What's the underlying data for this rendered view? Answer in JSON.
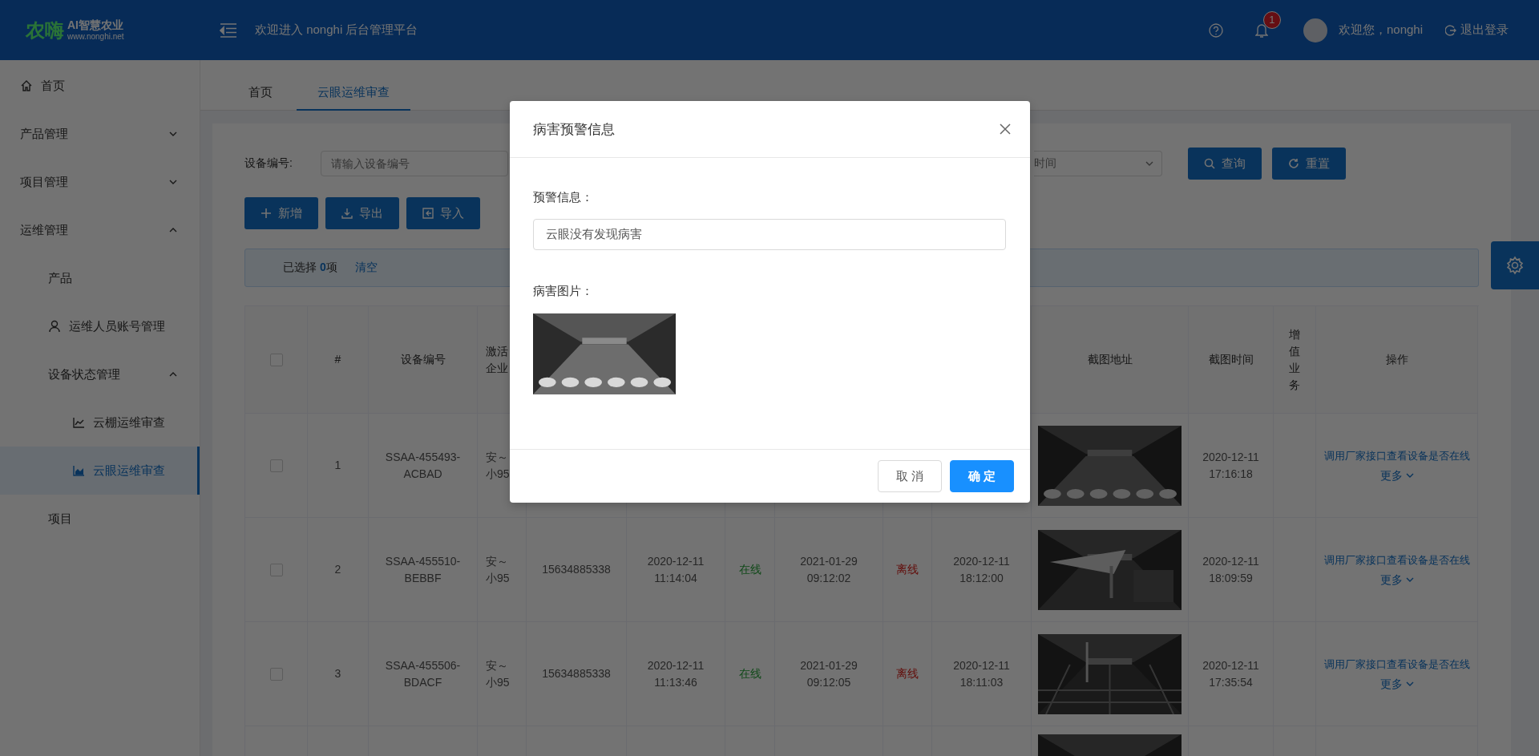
{
  "header": {
    "logo_mark": "农嗨",
    "logo_title": "AI智慧农业",
    "logo_url": "www.nonghi.net",
    "title": "欢迎进入 nonghi 后台管理平台",
    "notification_count": "1",
    "greeting": "欢迎您，nonghi",
    "logout": "退出登录"
  },
  "sidebar": {
    "items": [
      {
        "label": "首页",
        "kind": "home",
        "selected": false
      },
      {
        "label": "产品管理",
        "kind": "group",
        "expanded": false,
        "selected": false
      },
      {
        "label": "项目管理",
        "kind": "group",
        "expanded": false,
        "selected": false
      },
      {
        "label": "运维管理",
        "kind": "group",
        "expanded": true,
        "selected": false,
        "children": [
          {
            "label": "产品",
            "kind": "link",
            "selected": false
          },
          {
            "label": "运维人员账号管理",
            "kind": "user",
            "selected": false
          },
          {
            "label": "设备状态管理",
            "kind": "group",
            "expanded": true,
            "selected": false,
            "children": [
              {
                "label": "云棚运维审查",
                "kind": "linechart",
                "selected": false
              },
              {
                "label": "云眼运维审查",
                "kind": "areachart",
                "selected": true
              }
            ]
          },
          {
            "label": "项目",
            "kind": "link",
            "selected": false
          }
        ]
      }
    ]
  },
  "tabs": [
    {
      "label": "首页",
      "selected": false
    },
    {
      "label": "云眼运维审查",
      "selected": true
    }
  ],
  "filters": {
    "device_label": "设备编号:",
    "device_placeholder": "请输入设备编号",
    "time_placeholder": "时间",
    "buttons": [
      {
        "label": "查询",
        "kind": "search"
      },
      {
        "label": "重置",
        "kind": "reset"
      }
    ]
  },
  "toolbar": [
    {
      "label": "新增",
      "kind": "plus"
    },
    {
      "label": "导出",
      "kind": "export"
    },
    {
      "label": "导入",
      "kind": "import"
    }
  ],
  "selection": {
    "text": "已选择 **0**项",
    "clear": "清空"
  },
  "table": {
    "header": {
      "checked": false,
      "index": "#",
      "device_id": "设备编号",
      "company": "激活企业",
      "screenshot": "截图地址",
      "screenshot_time": "截图时间",
      "value_added": "增值业务",
      "actions": "操作"
    },
    "rows": [
      {
        "checked": false,
        "index": "1",
        "device_id": "SSAA-455493-ACBAD",
        "company": "安～小95",
        "screenshot": {
          "kind": "picture"
        },
        "screenshot_time": "2020-12-11 17:16:18",
        "action": "调用厂家接口查看设备是否在线",
        "more": "更多"
      },
      {
        "checked": false,
        "index": "2",
        "device_id": "SSAA-455510-BEBBF",
        "company": "安～小95",
        "sim": "15634885338",
        "activated": "2020-12-11 11:14:04",
        "status_a": {
          "text": "在线",
          "online": true
        },
        "time_b": "2021-01-29 09:12:02",
        "status_b": {
          "text": "离线",
          "online": false
        },
        "time_c": "2020-12-11 18:12:00",
        "screenshot": {
          "kind": "picture"
        },
        "screenshot_time": "2020-12-11 18:09:59",
        "action": "调用厂家接口查看设备是否在线",
        "more": "更多"
      },
      {
        "checked": false,
        "index": "3",
        "device_id": "SSAA-455506-BDACF",
        "company": "安～小95",
        "sim": "15634885338",
        "activated": "2020-12-11 11:13:46",
        "status_a": {
          "text": "在线",
          "online": true
        },
        "time_b": "2021-01-29 09:12:05",
        "status_b": {
          "text": "离线",
          "online": false
        },
        "time_c": "2020-12-11 18:11:03",
        "screenshot": {
          "kind": "picture"
        },
        "screenshot_time": "2020-12-11 17:35:54",
        "action": "调用厂家接口查看设备是否在线",
        "more": "更多"
      },
      {
        "screenshot": {
          "kind": "picture"
        }
      }
    ]
  },
  "modal": {
    "title": "病害预警信息",
    "info_label": "预警信息：",
    "info_value": "云眼没有发现病害",
    "image_label": "病害图片：",
    "image": {
      "kind": "picture"
    },
    "buttons": [
      {
        "label": "取 消",
        "kind": "secondary"
      },
      {
        "label": "确 定",
        "kind": "primary"
      }
    ]
  }
}
